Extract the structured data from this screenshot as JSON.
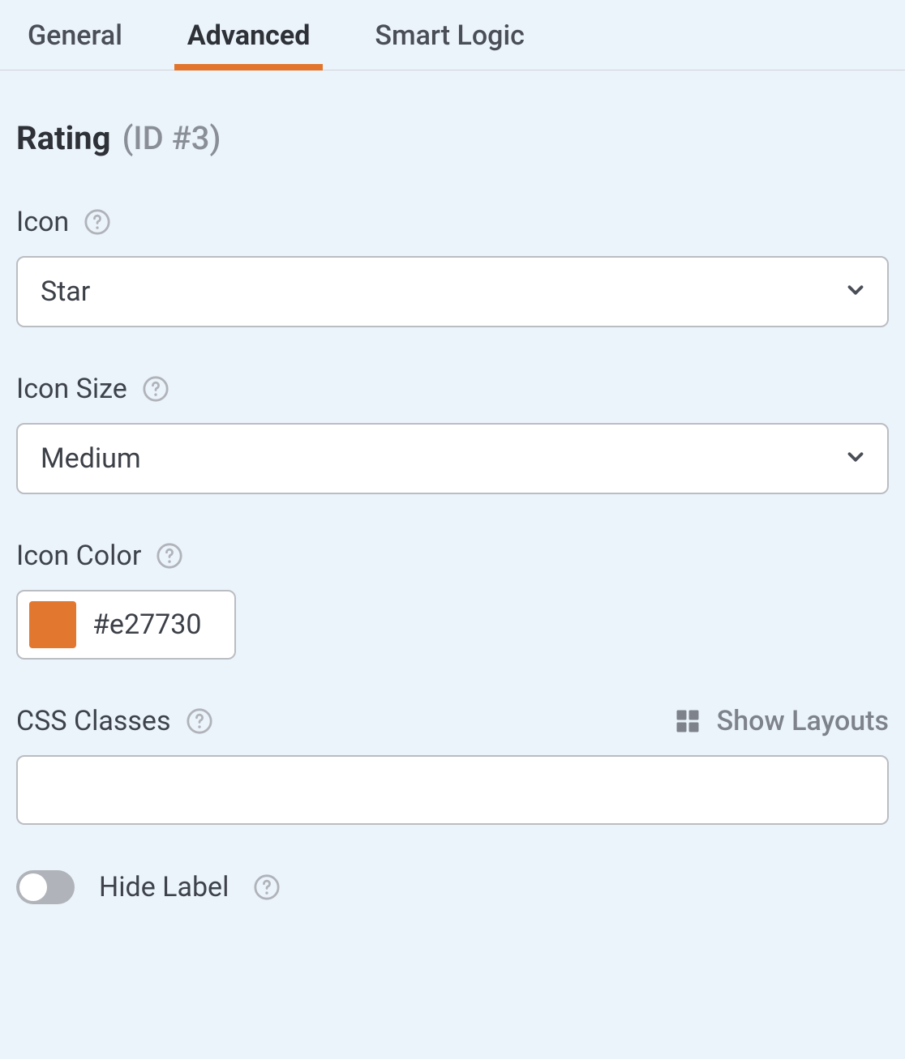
{
  "tabs": {
    "general": "General",
    "advanced": "Advanced",
    "smart_logic": "Smart Logic",
    "active": "advanced"
  },
  "header": {
    "title": "Rating",
    "id_label": "(ID #3)"
  },
  "fields": {
    "icon": {
      "label": "Icon",
      "value": "Star"
    },
    "icon_size": {
      "label": "Icon Size",
      "value": "Medium"
    },
    "icon_color": {
      "label": "Icon Color",
      "value": "#e27730",
      "swatch": "#e27730"
    },
    "css_classes": {
      "label": "CSS Classes",
      "show_layouts": "Show Layouts",
      "value": ""
    },
    "hide_label": {
      "label": "Hide Label",
      "on": false
    }
  }
}
